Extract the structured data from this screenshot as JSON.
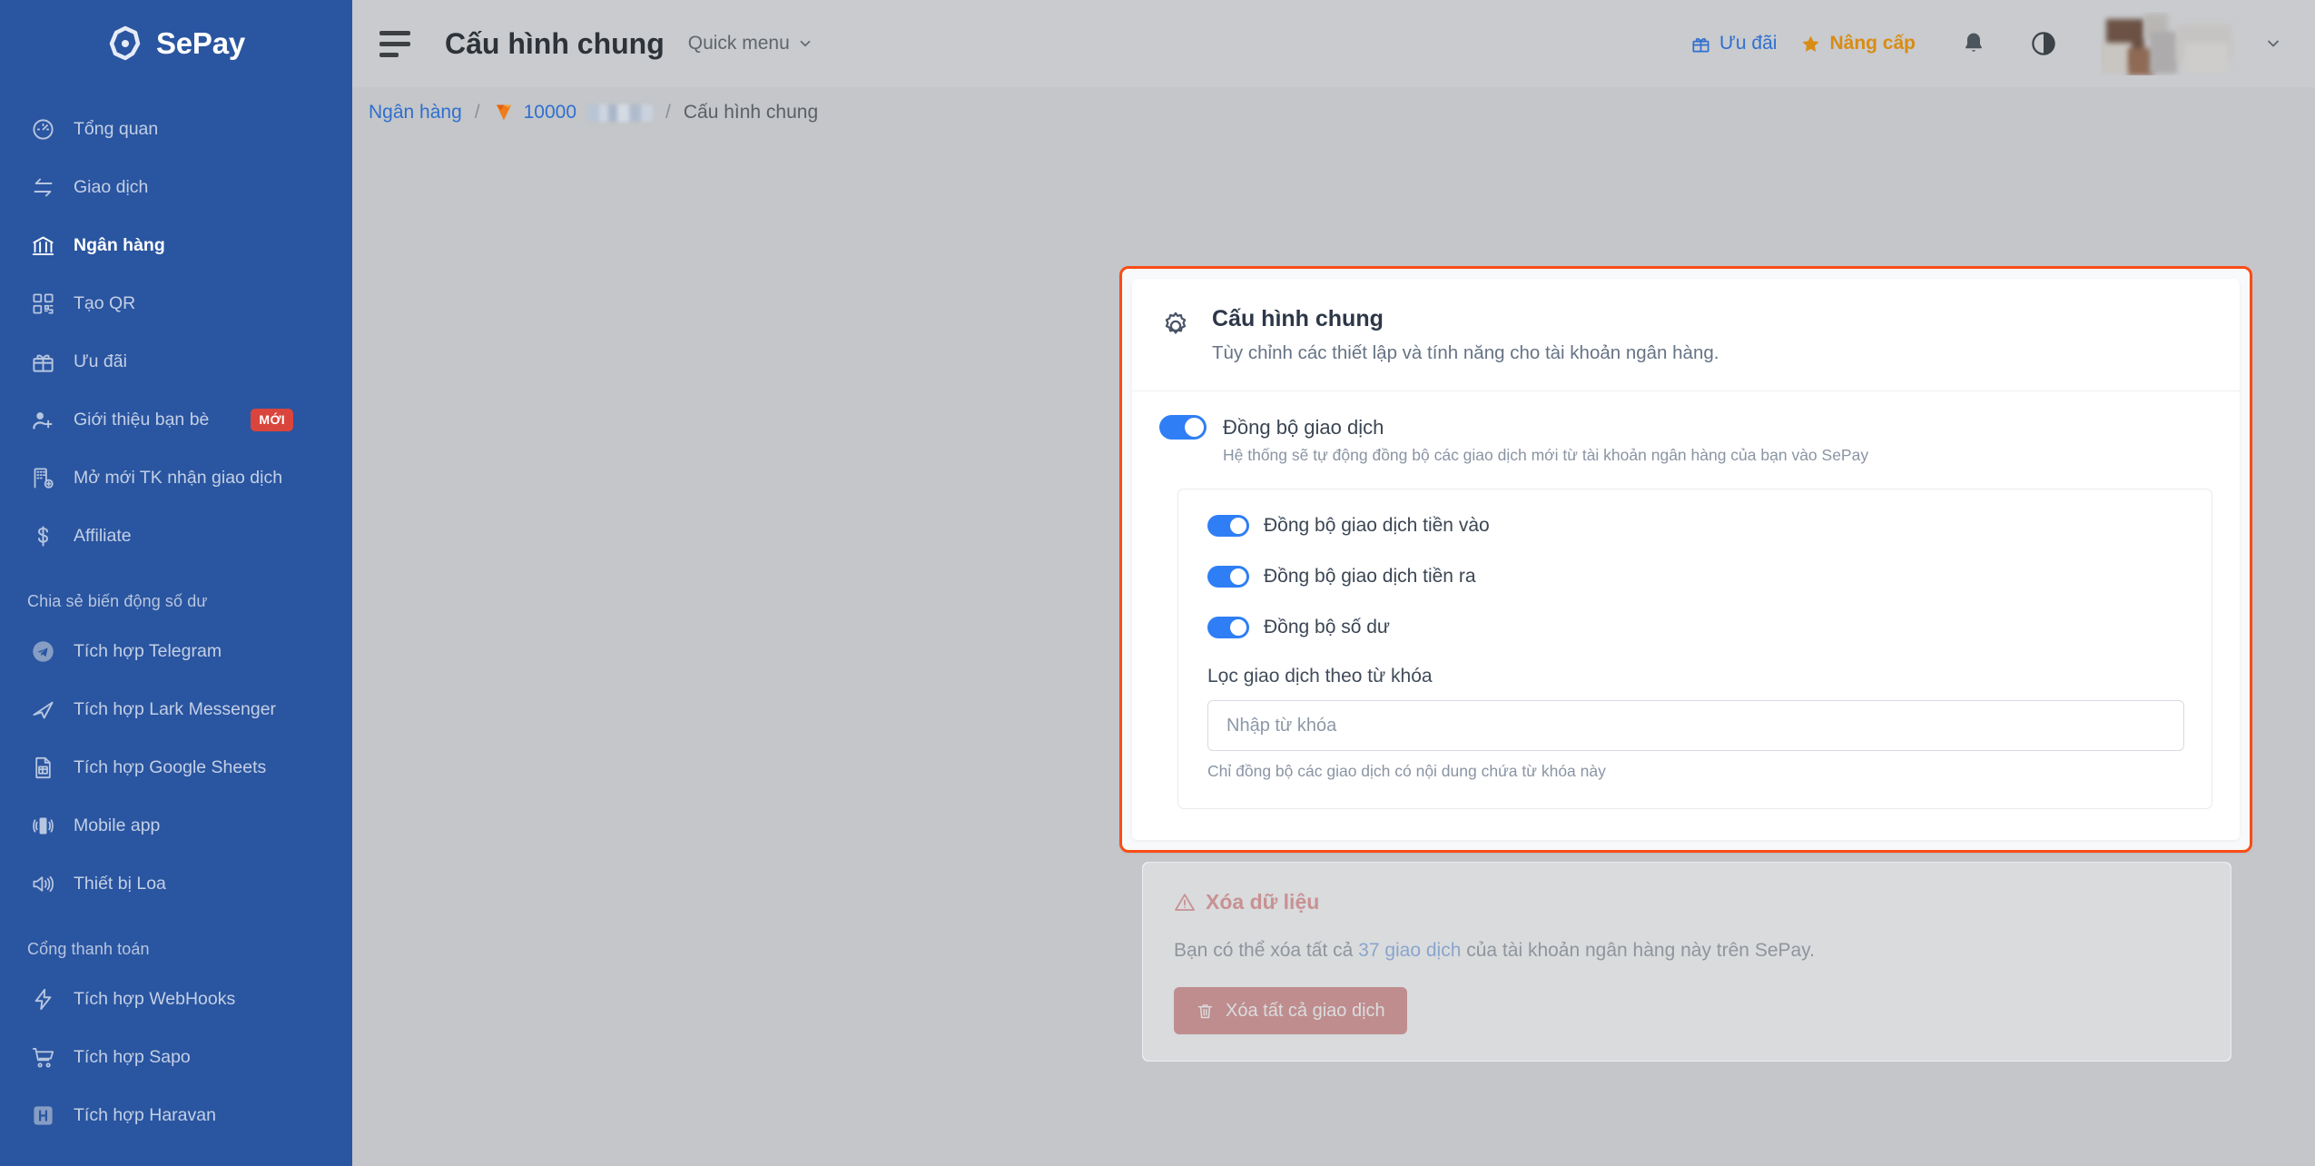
{
  "sidebar": {
    "brand": "SePay",
    "items": [
      {
        "label": "Tổng quan",
        "icon": "gauge-icon",
        "active": false
      },
      {
        "label": "Giao dịch",
        "icon": "transfer-icon",
        "active": false
      },
      {
        "label": "Ngân hàng",
        "icon": "bank-icon",
        "active": true
      },
      {
        "label": "Tạo QR",
        "icon": "qr-icon",
        "active": false
      },
      {
        "label": "Ưu đãi",
        "icon": "gift-icon",
        "active": false
      },
      {
        "label": "Giới thiệu bạn bè",
        "icon": "user-plus-icon",
        "active": false,
        "badge": "MỚI"
      },
      {
        "label": "Mở mới TK nhận giao dịch",
        "icon": "building-plus-icon",
        "active": false
      },
      {
        "label": "Affiliate",
        "icon": "dollar-icon",
        "active": false
      }
    ],
    "section_share": "Chia sẻ biến động số dư",
    "share_items": [
      {
        "label": "Tích hợp Telegram",
        "icon": "telegram-icon"
      },
      {
        "label": "Tích hợp Lark Messenger",
        "icon": "lark-icon"
      },
      {
        "label": "Tích hợp Google Sheets",
        "icon": "sheets-icon"
      },
      {
        "label": "Mobile app",
        "icon": "mobile-icon"
      },
      {
        "label": "Thiết bị Loa",
        "icon": "speaker-icon"
      }
    ],
    "section_gateway": "Cổng thanh toán",
    "gateway_items": [
      {
        "label": "Tích hợp WebHooks",
        "icon": "bolt-icon"
      },
      {
        "label": "Tích hợp Sapo",
        "icon": "cart-icon"
      },
      {
        "label": "Tích hợp Haravan",
        "icon": "haravan-icon"
      }
    ]
  },
  "topbar": {
    "page_title": "Cấu hình chung",
    "quick_menu": "Quick menu",
    "promo": "Ưu đãi",
    "upgrade": "Nâng cấp"
  },
  "breadcrumb": {
    "bank": "Ngân hàng",
    "account": "10000",
    "current": "Cấu hình chung",
    "separator": "/"
  },
  "card": {
    "title": "Cấu hình chung",
    "subtitle": "Tùy chỉnh các thiết lập và tính năng cho tài khoản ngân hàng.",
    "main_toggle": {
      "label": "Đồng bộ giao dịch",
      "description": "Hệ thống sẽ tự động đồng bộ các giao dịch mới từ tài khoản ngân hàng của bạn vào SePay",
      "state": "on"
    },
    "sub_toggles": [
      {
        "label": "Đồng bộ giao dịch tiền vào",
        "state": "on"
      },
      {
        "label": "Đồng bộ giao dịch tiền ra",
        "state": "on"
      },
      {
        "label": "Đồng bộ số dư",
        "state": "on"
      }
    ],
    "keyword_filter": {
      "label": "Lọc giao dịch theo từ khóa",
      "value": "",
      "placeholder": "Nhập từ khóa",
      "help": "Chỉ đồng bộ các giao dịch có nội dung chứa từ khóa này"
    }
  },
  "danger": {
    "title": "Xóa dữ liệu",
    "text_before": "Bạn có thể xóa tất cả ",
    "link": "37 giao dịch",
    "text_after": " của tài khoản ngân hàng này trên SePay.",
    "button": "Xóa tất cả giao dịch"
  },
  "colors": {
    "sidebar_blue": "#2A55A0",
    "accent_blue": "#2f7ef5",
    "link_blue": "#2f6fd0",
    "upgrade_orange": "#d98c14",
    "highlight_red": "#fb4c16",
    "danger_red": "#b8312f",
    "badge_red": "#d9453c",
    "page_bg": "#c4c6c9"
  }
}
